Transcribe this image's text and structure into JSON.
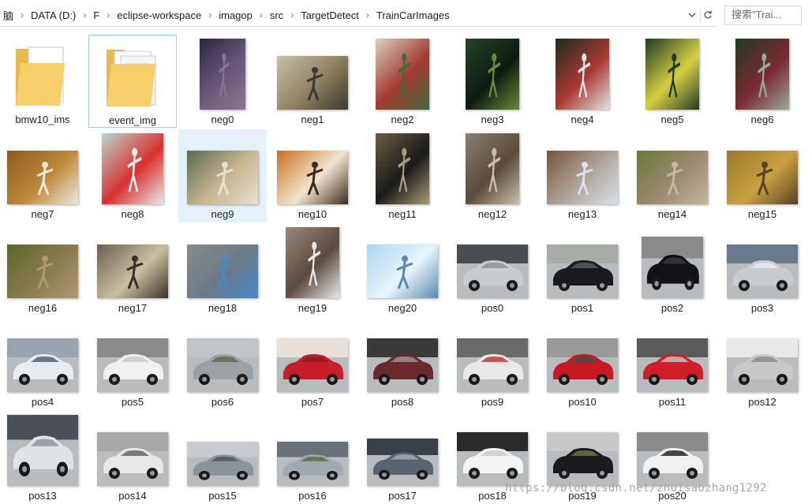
{
  "address_bar": {
    "breadcrumbs": [
      "脑",
      "DATA (D:)",
      "F",
      "eclipse-workspace",
      "imagop",
      "src",
      "TargetDetect",
      "TrainCarImages"
    ]
  },
  "search": {
    "placeholder": "搜索\"Trai..."
  },
  "items": [
    {
      "name": "bmw10_ims",
      "kind": "folder"
    },
    {
      "name": "event_img",
      "kind": "folder",
      "state": "focused"
    },
    {
      "name": "neg0",
      "kind": "image",
      "colors": [
        "#2c2640",
        "#6a5a7a",
        "#8a7590"
      ]
    },
    {
      "name": "neg1",
      "kind": "image",
      "colors": [
        "#c9c2a8",
        "#8b7f5e",
        "#3a3a2e"
      ]
    },
    {
      "name": "neg2",
      "kind": "image",
      "colors": [
        "#d8d2c0",
        "#a33a30",
        "#3c6a3a"
      ]
    },
    {
      "name": "neg3",
      "kind": "image",
      "colors": [
        "#27442a",
        "#0e1a10",
        "#6a8a3a"
      ]
    },
    {
      "name": "neg4",
      "kind": "image",
      "colors": [
        "#1c2a1e",
        "#a83a34",
        "#e2e2e2"
      ]
    },
    {
      "name": "neg5",
      "kind": "image",
      "colors": [
        "#1f3a22",
        "#d4cf40",
        "#253a26"
      ]
    },
    {
      "name": "neg6",
      "kind": "image",
      "colors": [
        "#1e3a22",
        "#7a2a34",
        "#9aa89a"
      ]
    },
    {
      "name": "neg7",
      "kind": "image",
      "colors": [
        "#8a5a22",
        "#c08a3a",
        "#efe8dc"
      ]
    },
    {
      "name": "neg8",
      "kind": "image",
      "colors": [
        "#b8d8d0",
        "#d93030",
        "#e8e8e8"
      ]
    },
    {
      "name": "neg9",
      "kind": "image",
      "colors": [
        "#5a6a52",
        "#c8b890",
        "#e8e0d0"
      ],
      "state": "selected"
    },
    {
      "name": "neg10",
      "kind": "image",
      "colors": [
        "#c8701c",
        "#f2e4d0",
        "#3a2a20"
      ]
    },
    {
      "name": "neg11",
      "kind": "image",
      "colors": [
        "#6a5e48",
        "#1a1a1a",
        "#a89a7a"
      ]
    },
    {
      "name": "neg12",
      "kind": "image",
      "colors": [
        "#8a8070",
        "#5a4a3a",
        "#c8c0b0"
      ]
    },
    {
      "name": "neg13",
      "kind": "image",
      "colors": [
        "#7a5438",
        "#b0a8a0",
        "#d8e0e8"
      ]
    },
    {
      "name": "neg14",
      "kind": "image",
      "colors": [
        "#6a7a3a",
        "#9a8a70",
        "#c0b8a0"
      ]
    },
    {
      "name": "neg15",
      "kind": "image",
      "colors": [
        "#9a7a28",
        "#c8a040",
        "#5a4028"
      ]
    },
    {
      "name": "neg16",
      "kind": "image",
      "colors": [
        "#5a6a28",
        "#8a7a50",
        "#b09a70"
      ]
    },
    {
      "name": "neg17",
      "kind": "image",
      "colors": [
        "#6a6050",
        "#c8c0a0",
        "#3a3028"
      ]
    },
    {
      "name": "neg18",
      "kind": "image",
      "colors": [
        "#8a8a88",
        "#6a7a8a",
        "#4a88c8"
      ]
    },
    {
      "name": "neg19",
      "kind": "image",
      "colors": [
        "#9a8878",
        "#5a4a40",
        "#e8e8e8"
      ]
    },
    {
      "name": "neg20",
      "kind": "image",
      "colors": [
        "#a8d8f0",
        "#e8f4fa",
        "#5a8ab0"
      ]
    },
    {
      "name": "pos0",
      "kind": "image",
      "colors": [
        "#c8ccd0",
        "#8a8e92",
        "#4a4e52"
      ]
    },
    {
      "name": "pos1",
      "kind": "image",
      "colors": [
        "#1a1a1e",
        "#5a5e62",
        "#a8aca8"
      ]
    },
    {
      "name": "pos2",
      "kind": "image",
      "colors": [
        "#121216",
        "#3a3a40",
        "#8a8a8a"
      ]
    },
    {
      "name": "pos3",
      "kind": "image",
      "colors": [
        "#c8ccd0",
        "#e8eaec",
        "#6a7a8a"
      ]
    },
    {
      "name": "pos4",
      "kind": "image",
      "colors": [
        "#e8ecf0",
        "#4a5a6a",
        "#9aa4ae"
      ]
    },
    {
      "name": "pos5",
      "kind": "image",
      "colors": [
        "#f0f0f0",
        "#c8c8c8",
        "#8a8a8a"
      ]
    },
    {
      "name": "pos6",
      "kind": "image",
      "colors": [
        "#9aa0a6",
        "#5a6a4a",
        "#c0c4c8"
      ]
    },
    {
      "name": "pos7",
      "kind": "image",
      "colors": [
        "#c81e2a",
        "#8a1a20",
        "#e8e0d8"
      ]
    },
    {
      "name": "pos8",
      "kind": "image",
      "colors": [
        "#6a2a2e",
        "#9a9a9a",
        "#3a3a3a"
      ]
    },
    {
      "name": "pos9",
      "kind": "image",
      "colors": [
        "#e8e8e8",
        "#c03030",
        "#6a6a6a"
      ]
    },
    {
      "name": "pos10",
      "kind": "image",
      "colors": [
        "#c81a24",
        "#4a4a4a",
        "#9a9a9a"
      ]
    },
    {
      "name": "pos11",
      "kind": "image",
      "colors": [
        "#d01e2a",
        "#c8c8c8",
        "#5a5a5a"
      ]
    },
    {
      "name": "pos12",
      "kind": "image",
      "colors": [
        "#c8c8c8",
        "#8a8a8a",
        "#e8e8e8"
      ]
    },
    {
      "name": "pos13",
      "kind": "image",
      "colors": [
        "#e0e2e4",
        "#8a9098",
        "#4a5058"
      ]
    },
    {
      "name": "pos14",
      "kind": "image",
      "colors": [
        "#e8e8e8",
        "#5a5a5a",
        "#a8a8a8"
      ]
    },
    {
      "name": "pos15",
      "kind": "image",
      "colors": [
        "#8a929a",
        "#4a525a",
        "#c8ccd0"
      ]
    },
    {
      "name": "pos16",
      "kind": "image",
      "colors": [
        "#a0a8b0",
        "#5a6a3a",
        "#6a7078"
      ]
    },
    {
      "name": "pos17",
      "kind": "image",
      "colors": [
        "#5a6470",
        "#a8b0b8",
        "#3a4048"
      ]
    },
    {
      "name": "pos18",
      "kind": "image",
      "colors": [
        "#f4f4f4",
        "#c8c8c8",
        "#2a2a2a"
      ]
    },
    {
      "name": "pos19",
      "kind": "image",
      "colors": [
        "#1a1a1e",
        "#6a7a4a",
        "#c8c8c8"
      ]
    },
    {
      "name": "pos20",
      "kind": "image",
      "colors": [
        "#f0f0f0",
        "#1a1a1a",
        "#8a8a8a"
      ]
    }
  ],
  "watermark": "https://blog.csdn.net/zhuisaozhang1292"
}
